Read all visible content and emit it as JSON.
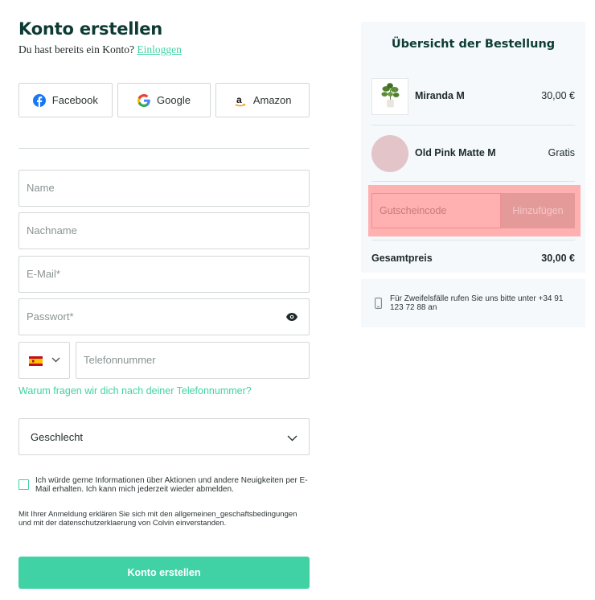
{
  "form": {
    "title": "Konto erstellen",
    "subtitle_prefix": "Du hast bereits ein Konto?",
    "login_link": "Einloggen",
    "social": {
      "facebook": "Facebook",
      "google": "Google",
      "amazon": "Amazon"
    },
    "fields": {
      "name": "Name",
      "lastname": "Nachname",
      "email": "E-Mail*",
      "password": "Passwort*",
      "phone": "Telefonnummer"
    },
    "phone_why": "Warum fragen wir dich nach deiner Telefonnummer?",
    "gender": "Geschlecht",
    "newsletter": "Ich würde gerne Informationen über Aktionen und andere Neuigkeiten per E-Mail erhalten. Ich kann mich jederzeit wieder abmelden.",
    "legal": "Mit Ihrer Anmeldung erklären Sie sich mit den allgemeinen_geschaftsbedingungen und mit der datenschutzerklaerung von Colvin einverstanden.",
    "submit": "Konto erstellen"
  },
  "summary": {
    "title": "Übersicht der Bestellung",
    "items": [
      {
        "name": "Miranda M",
        "price": "30,00 €"
      },
      {
        "name": "Old Pink Matte M",
        "price": "Gratis"
      }
    ],
    "coupon_placeholder": "Gutscheincode",
    "coupon_button": "Hinzufügen",
    "total_label": "Gesamtpreis",
    "total_value": "30,00 €"
  },
  "help": {
    "text": "Für Zweifelsfälle rufen Sie uns bitte unter +34 91 123 72 88 an"
  },
  "colors": {
    "brand": "#0d3b33",
    "accent": "#3ed3a3",
    "highlight": "#ffb0b0"
  }
}
